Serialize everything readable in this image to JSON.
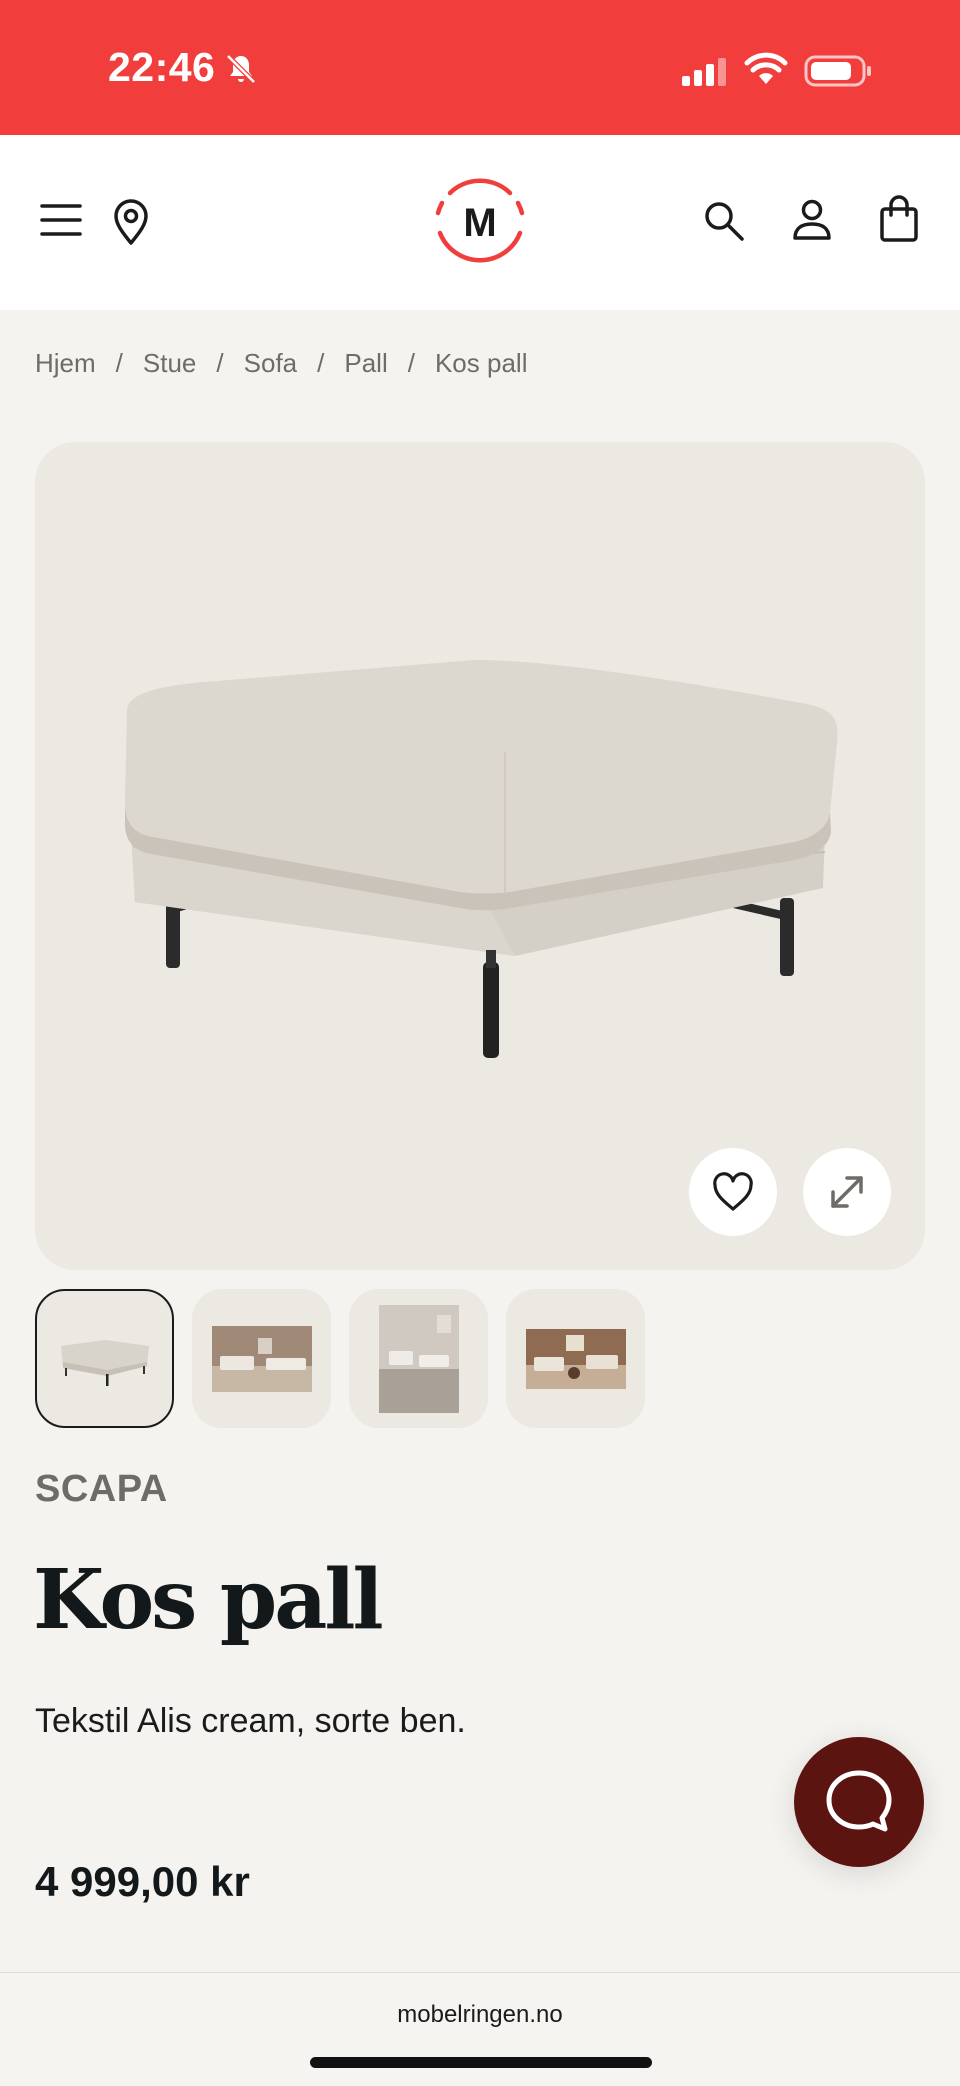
{
  "status_bar": {
    "time": "22:46",
    "icons": [
      "bell-muted-icon",
      "signal-icon",
      "wifi-icon",
      "battery-icon"
    ]
  },
  "header": {
    "logo_letter": "M",
    "icons": [
      "menu-icon",
      "location-pin-icon",
      "search-icon",
      "user-icon",
      "shopping-bag-icon"
    ],
    "brand_color": "#f23d3d"
  },
  "breadcrumb": [
    "Hjem",
    "Stue",
    "Sofa",
    "Pall",
    "Kos pall"
  ],
  "breadcrumb_separator": "/",
  "gallery": {
    "thumbnail_count": 4,
    "active_index": 0,
    "actions": [
      "heart-icon",
      "expand-icon"
    ]
  },
  "product": {
    "brand": "SCAPA",
    "title": "Kos pall",
    "description": "Tekstil Alis cream, sorte ben.",
    "price": "4 999,00 kr"
  },
  "chat": {
    "icon": "chat-bubble-icon",
    "color": "#5c1411"
  },
  "browser": {
    "url": "mobelringen.no"
  }
}
